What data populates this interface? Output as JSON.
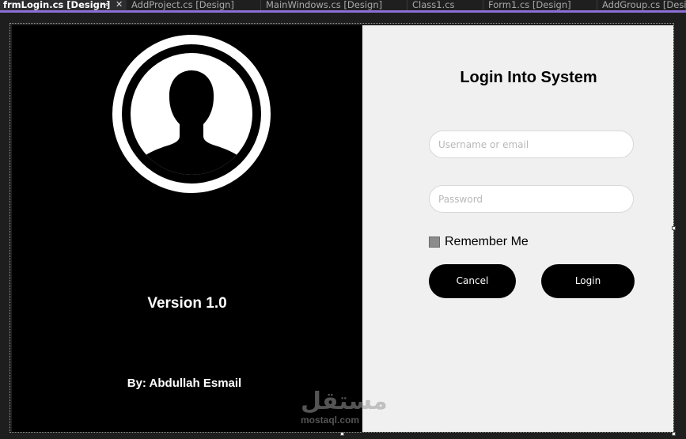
{
  "tabs": [
    {
      "label": "frmLogin.cs [Design]",
      "active": true
    },
    {
      "label": "AddProject.cs [Design]"
    },
    {
      "label": "MainWindows.cs [Design]"
    },
    {
      "label": "Class1.cs"
    },
    {
      "label": "Form1.cs [Design]"
    },
    {
      "label": "AddGroup.cs [Design]"
    }
  ],
  "tab_icons": {
    "pin": "pin-icon",
    "close": "close-icon"
  },
  "left_panel": {
    "avatar_icon": "user-silhouette-icon",
    "version": "Version 1.0",
    "author": "By: Abdullah Esmail"
  },
  "login_form": {
    "title": "Login Into System",
    "username_placeholder": "Username or email",
    "username_value": "",
    "password_placeholder": "Password",
    "password_value": "",
    "remember_label": "Remember Me",
    "remember_checked": false,
    "cancel_label": "Cancel",
    "login_label": "Login"
  },
  "watermark": {
    "glyph": "مستقل",
    "text": "mostaql.com"
  },
  "colors": {
    "accent": "#8c6fd6",
    "left_bg": "#000000",
    "right_bg": "#f0f0f0",
    "button_bg": "#000000"
  }
}
